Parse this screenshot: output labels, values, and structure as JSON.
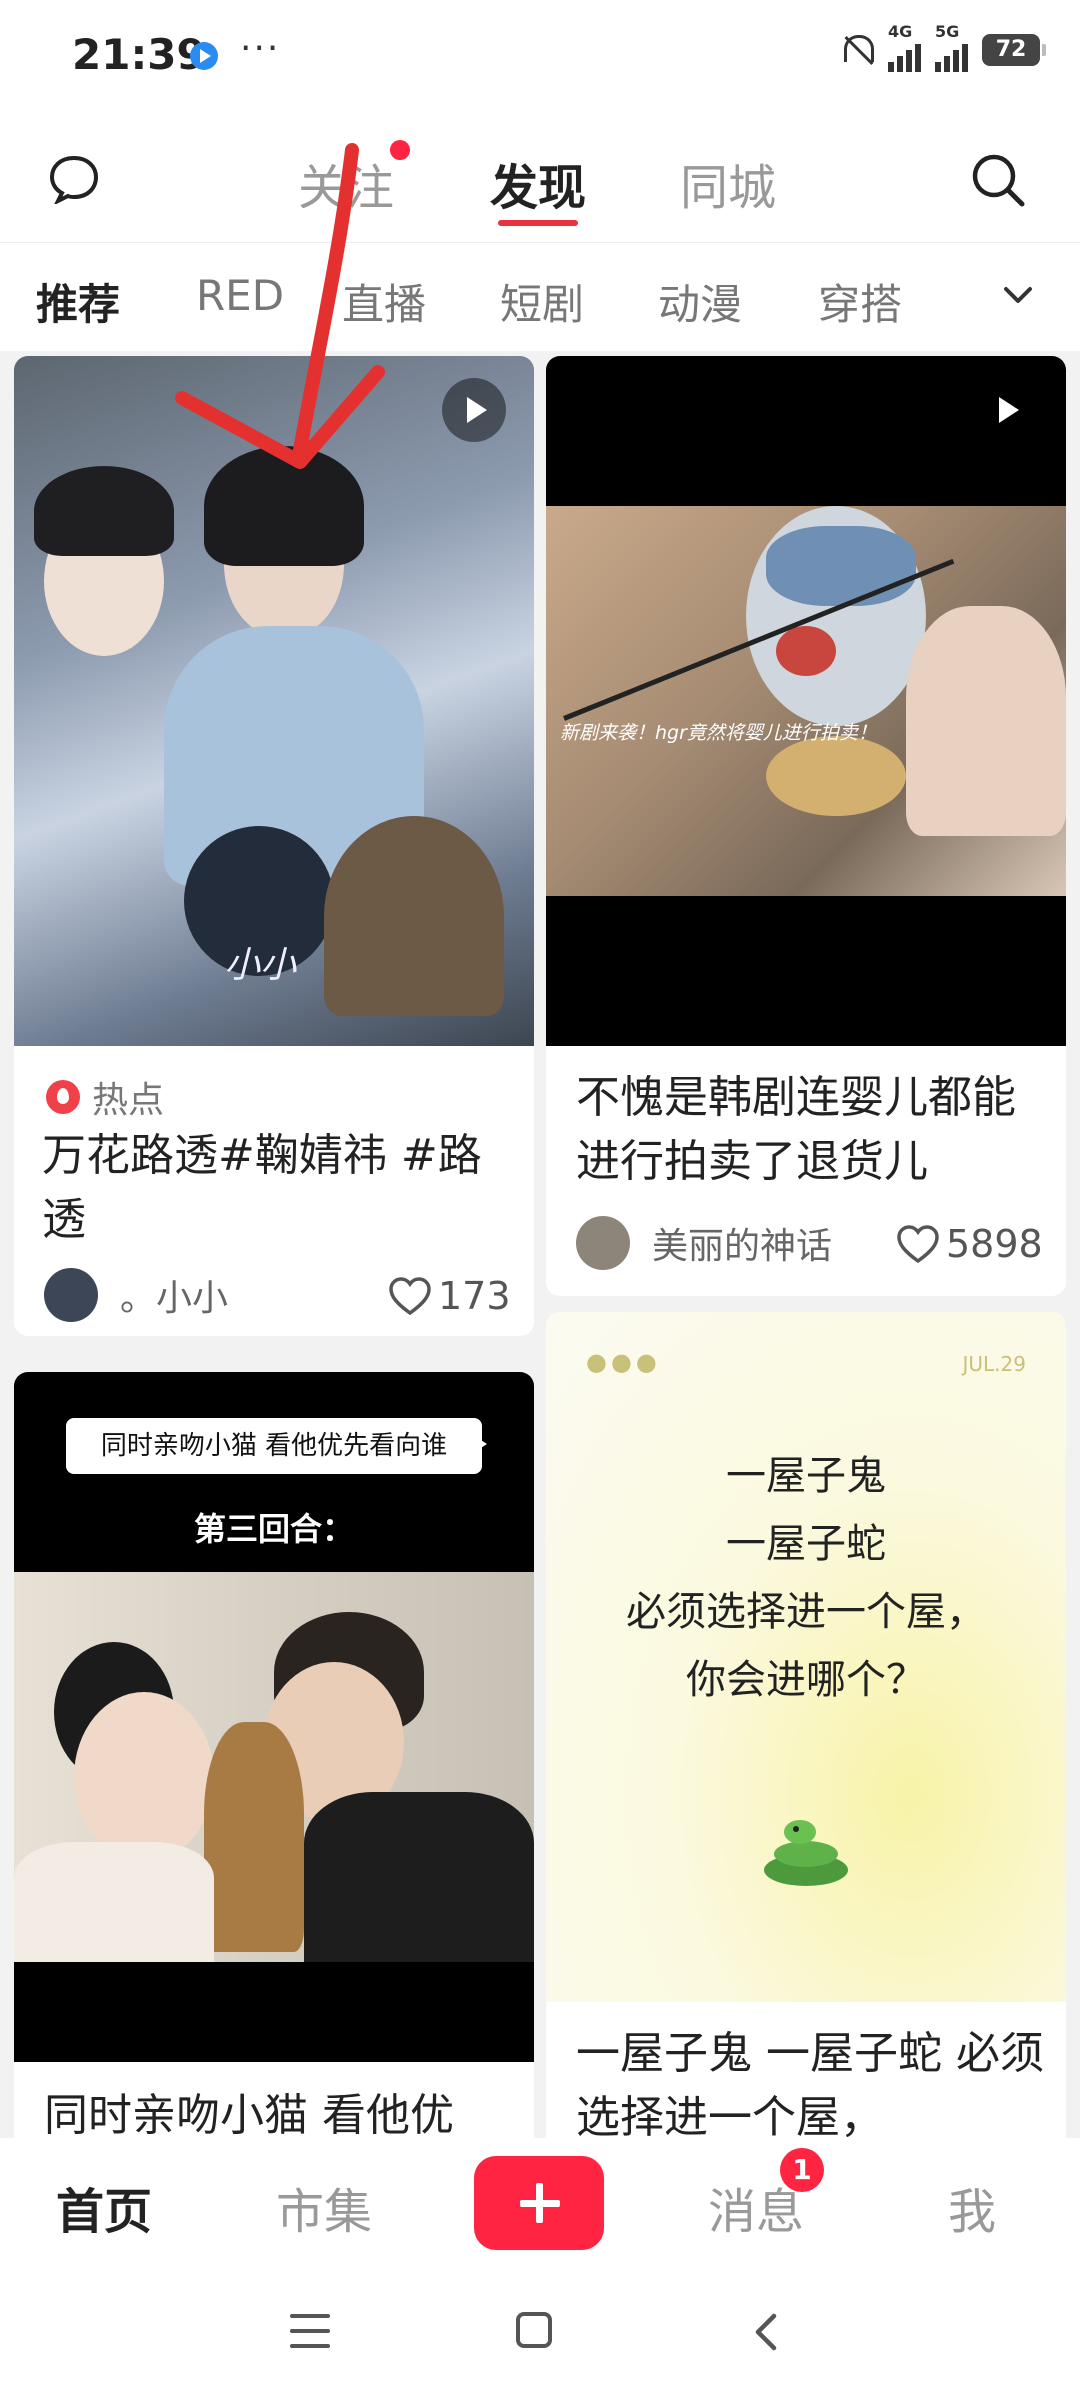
{
  "status": {
    "time": "21:39",
    "net1": "4G",
    "net2": "5G",
    "battery": "72"
  },
  "top_tabs": [
    "关注",
    "发现",
    "同城"
  ],
  "categories": [
    "推荐",
    "RED",
    "直播",
    "短剧",
    "动漫",
    "穿搭"
  ],
  "cards": [
    {
      "tag": "热点",
      "title": "万花路透#鞠婧祎 #路透",
      "author": "。小小",
      "likes": "173",
      "image_caption": "小小"
    },
    {
      "title": "不愧是韩剧连婴儿都能进行拍卖了退货儿",
      "author": "美丽的神话",
      "likes": "5898",
      "image_caption": "新剧来袭！hgr竟然将婴儿进行拍卖！"
    },
    {
      "title": "同时亲吻小猫 看他优",
      "image_caption": "同时亲吻小猫 看他优先看向谁",
      "image_caption2": "第三回合："
    },
    {
      "title": "一屋子鬼 一屋子蛇 必须选择进一个屋，",
      "image_date": "JUL.29",
      "image_lines": [
        "一屋子鬼",
        "一屋子蛇",
        "必须选择进一个屋，",
        "你会进哪个？"
      ]
    }
  ],
  "bottom_tabs": {
    "home": "首页",
    "market": "市集",
    "messages": "消息",
    "me": "我",
    "badge": "1"
  },
  "colors": {
    "accent": "#ff2442",
    "annotation": "#e53030"
  }
}
